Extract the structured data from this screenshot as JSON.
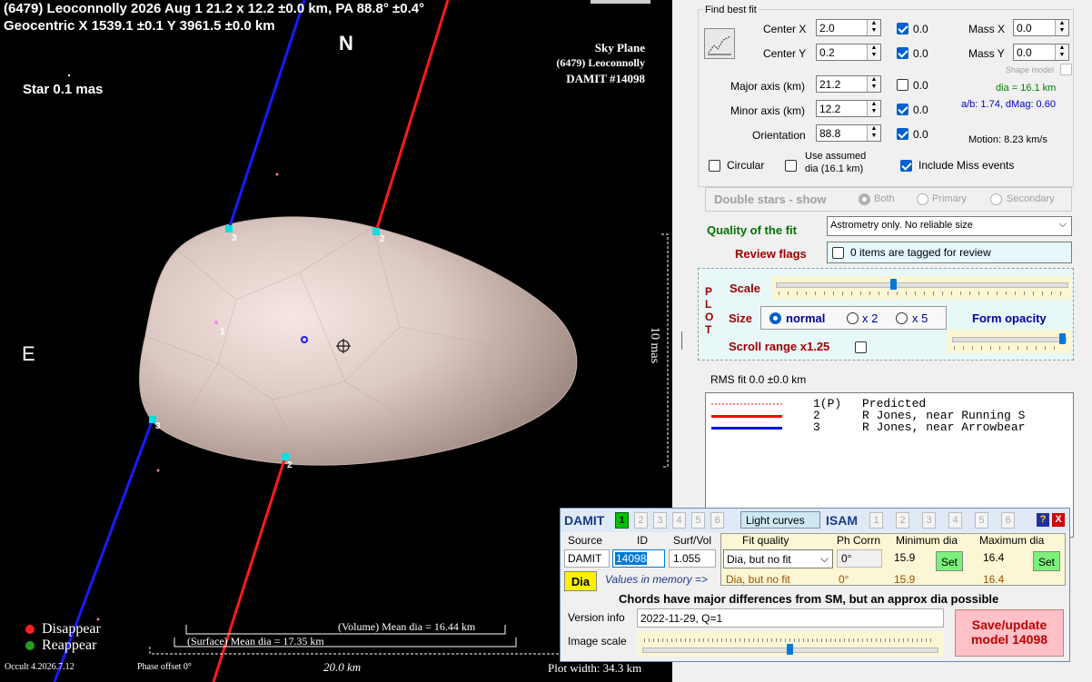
{
  "plot": {
    "header_line1": "(6479) Leoconnolly  2026 Aug 1  21.2 x 12.2 ±0.0 km, PA 88.8° ±0.4°",
    "header_line2": "Geocentric X 1539.1 ±0.1  Y 3961.5 ±0.0 km",
    "north_label": "N",
    "east_label": "E",
    "star_label": "Star 0.1 mas",
    "sky_plane_title": "Sky Plane",
    "sky_plane_object": "(6479) Leoconnolly",
    "sky_plane_damit": "DAMIT #14098",
    "scale_mas": "10 mas",
    "chord_labels": [
      "1",
      "2",
      "2",
      "3",
      "3"
    ],
    "legend_disappear": "Disappear",
    "legend_reappear": "Reappear",
    "volume_mean_dia": "(Volume) Mean dia = 16.44 km",
    "surface_mean_dia": "(Surface) Mean dia = 17.35 km",
    "scale_bar_km": "20.0 km",
    "occult_version": "Occult 4.2026.7.12",
    "phase_offset": "Phase offset 0°",
    "plot_width": "Plot width: 34.3 km",
    "colors": {
      "disappear": "#ff2020",
      "reappear": "#20a020",
      "chord_red": "#ff1a1a",
      "chord_blue": "#1a1aff",
      "asteroid": "#d8c4bc"
    }
  },
  "fit": {
    "section_title": "Find best fit",
    "center_x_label": "Center X",
    "center_x_value": "2.0",
    "center_x_err": "0.0",
    "center_y_label": "Center Y",
    "center_y_value": "0.2",
    "center_y_err": "0.0",
    "major_label": "Major axis (km)",
    "major_value": "21.2",
    "major_err": "0.0",
    "minor_label": "Minor axis (km)",
    "minor_value": "12.2",
    "minor_err": "0.0",
    "orient_label": "Orientation",
    "orient_value": "88.8",
    "orient_err": "0.0",
    "mass_x_label": "Mass X",
    "mass_x_value": "0.0",
    "mass_y_label": "Mass Y",
    "mass_y_value": "0.0",
    "shape_model_label": "Shape model",
    "dia_text": "dia = 16.1 km",
    "ab_text": "a/b: 1.74, dMag: 0.60",
    "motion_text": "Motion: 8.23 km/s",
    "circular_label": "Circular",
    "use_assumed_label_1": "Use assumed",
    "use_assumed_label_2": "dia (16.1 km)",
    "include_miss_label": "Include Miss events"
  },
  "double_stars": {
    "title": "Double stars - show",
    "both": "Both",
    "primary": "Primary",
    "secondary": "Secondary"
  },
  "quality": {
    "label": "Quality of the fit",
    "value": "Astrometry only. No reliable size",
    "review_label": "Review flags",
    "review_value": "0 items are tagged for review"
  },
  "plot_ctrl": {
    "plot_letters": [
      "P",
      "L",
      "O",
      "T"
    ],
    "scale_label": "Scale",
    "scale_level": 0.4,
    "size_label": "Size",
    "size_normal": "normal",
    "size_x2": "x 2",
    "size_x5": "x 5",
    "form_opacity_label": "Form opacity",
    "opacity_level": 1.0,
    "scroll_range_label": "Scroll range x1.25"
  },
  "rms": "RMS fit 0.0 ±0.0 km",
  "observers": [
    {
      "num": "1(P)",
      "name": "Predicted",
      "color": "#ff8080",
      "style": "dotted"
    },
    {
      "num": "2",
      "name": "R Jones, near Running S",
      "color": "#ff0000",
      "style": "solid"
    },
    {
      "num": "3",
      "name": "R Jones, near Arrowbear",
      "color": "#0000ff",
      "style": "solid"
    }
  ],
  "damit": {
    "title": "DAMIT",
    "model_numbers": [
      "1",
      "2",
      "3",
      "4",
      "5",
      "6"
    ],
    "active_model": "1",
    "light_curves": "Light curves",
    "isam_title": "ISAM",
    "isam_numbers": [
      "1",
      "2",
      "3",
      "4",
      "5",
      "6"
    ],
    "help_icon": "?",
    "close_icon": "X",
    "source_header": "Source",
    "id_header": "ID",
    "surfvol_header": "Surf/Vol",
    "fitq_header": "Fit quality",
    "phcorr_header": "Ph Corrn",
    "mindia_header": "Minimum dia",
    "maxdia_header": "Maximum dia",
    "source_value": "DAMIT",
    "id_value": "14098",
    "surfvol_value": "1.055",
    "fitq_value": "Dia, but no fit",
    "phcorr_value": "0°",
    "mindia_value": "15.9",
    "maxdia_value": "16.4",
    "set_label": "Set",
    "dia_button": "Dia",
    "values_in_memory": "Values in memory =>",
    "mem_fitq": "Dia, but no fit",
    "mem_phcorr": "0°",
    "mem_min": "15.9",
    "mem_max": "16.4",
    "chords_message": "Chords have major differences from SM, but an approx dia possible",
    "version_label": "Version info",
    "version_value": "2022-11-29, Q=1",
    "image_scale_label": "Image scale",
    "image_scale_level": 0.5,
    "save_line1": "Save/update",
    "save_line2": "model 14098"
  }
}
